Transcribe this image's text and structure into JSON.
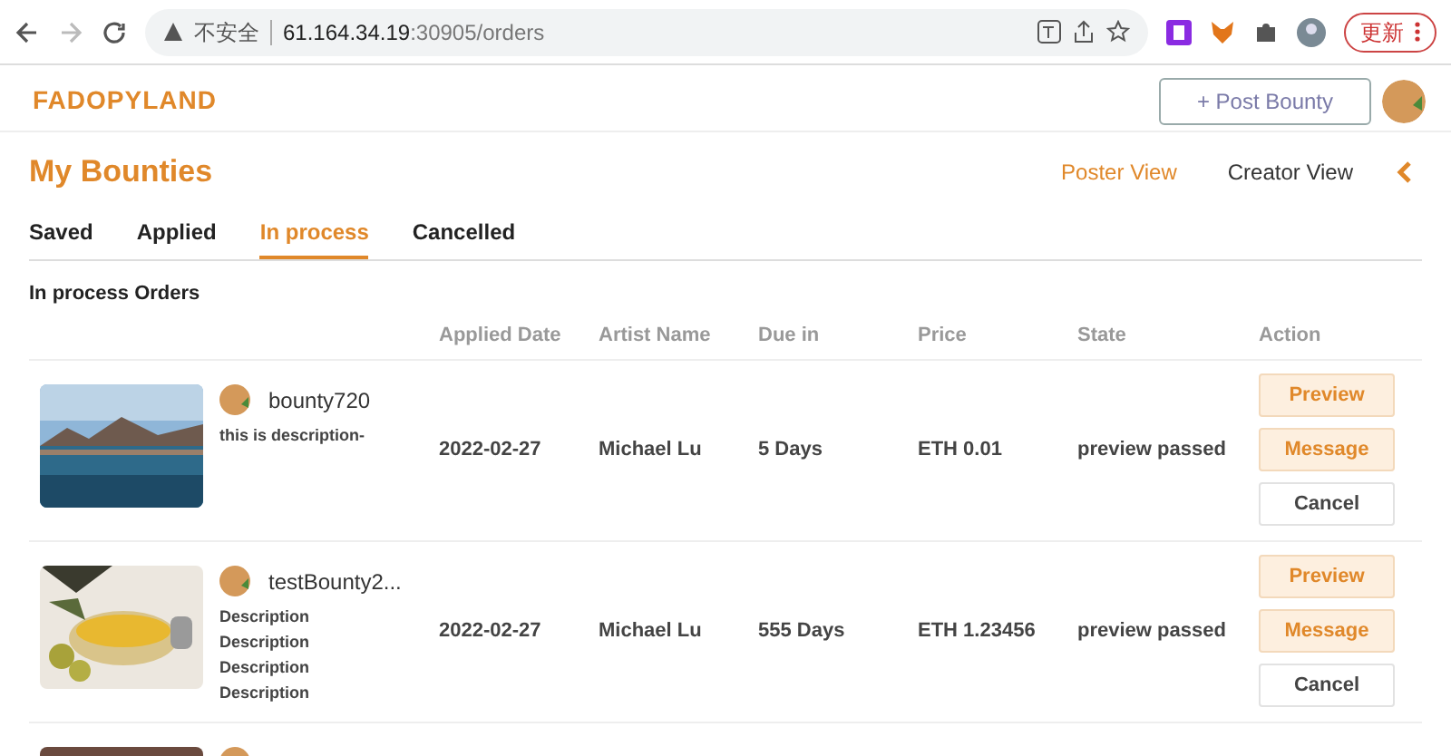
{
  "browser": {
    "security_label": "不安全",
    "url_host": "61.164.34.19",
    "url_path": ":30905/orders",
    "update_button": "更新"
  },
  "header": {
    "logo": "FADOPYLAND",
    "post_button": "+ Post Bounty"
  },
  "page": {
    "title": "My Bounties",
    "views": [
      {
        "label": "Poster View",
        "selected": true
      },
      {
        "label": "Creator View",
        "selected": false
      }
    ]
  },
  "tabs": [
    {
      "label": "Saved",
      "selected": false
    },
    {
      "label": "Applied",
      "selected": false
    },
    {
      "label": "In process",
      "selected": true
    },
    {
      "label": "Cancelled",
      "selected": false
    }
  ],
  "section_title": "In process Orders",
  "table": {
    "columns": [
      "Applied Date",
      "Artist Name",
      "Due in",
      "Price",
      "State",
      "Action"
    ],
    "rows": [
      {
        "kind": "full",
        "title": "bounty720",
        "description": [
          "this is description-"
        ],
        "applied_date": "2022-02-27",
        "artist": "Michael Lu",
        "due": "5 Days",
        "price": "ETH 0.01",
        "state": "preview passed",
        "actions": [
          "Preview",
          "Message",
          "Cancel"
        ]
      },
      {
        "kind": "full",
        "title": "testBounty2...",
        "description": [
          "Description",
          "Description",
          "Description",
          "Description"
        ],
        "applied_date": "2022-02-27",
        "artist": "Michael Lu",
        "due": "555 Days",
        "price": "ETH 1.23456",
        "state": "preview passed",
        "actions": [
          "Preview",
          "Message",
          "Cancel"
        ]
      },
      {
        "kind": "cut"
      }
    ]
  }
}
